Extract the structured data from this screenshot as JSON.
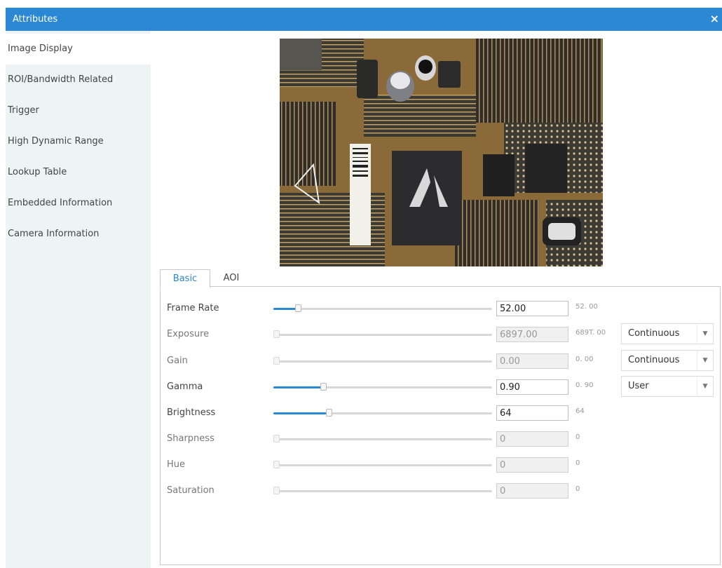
{
  "window": {
    "title": "Attributes",
    "close_glyph": "×"
  },
  "sidebar": {
    "items": [
      {
        "label": "Image Display",
        "active": true
      },
      {
        "label": "ROI/Bandwidth Related",
        "active": false
      },
      {
        "label": "Trigger",
        "active": false
      },
      {
        "label": "High Dynamic Range",
        "active": false
      },
      {
        "label": "Lookup Table",
        "active": false
      },
      {
        "label": "Embedded Information",
        "active": false
      },
      {
        "label": "Camera Information",
        "active": false
      }
    ]
  },
  "tabs": [
    {
      "label": "Basic",
      "active": true
    },
    {
      "label": "AOI",
      "active": false
    }
  ],
  "params": {
    "frame_rate": {
      "label": "Frame Rate",
      "value": "52.00",
      "max": "52. 00",
      "enabled": true,
      "level": 0.11
    },
    "exposure": {
      "label": "Exposure",
      "value": "6897.00",
      "max": "689T. 00",
      "enabled": false,
      "level": 0.0,
      "mode": "Continuous"
    },
    "gain": {
      "label": "Gain",
      "value": "0.00",
      "max": "0. 00",
      "enabled": false,
      "level": 0.0,
      "mode": "Continuous"
    },
    "gamma": {
      "label": "Gamma",
      "value": "0.90",
      "max": "0. 90",
      "enabled": true,
      "level": 0.23,
      "mode": "User"
    },
    "brightness": {
      "label": "Brightness",
      "value": "64",
      "max": "64",
      "enabled": true,
      "level": 0.25
    },
    "sharpness": {
      "label": "Sharpness",
      "value": "0",
      "max": "0",
      "enabled": false,
      "level": 0.0
    },
    "hue": {
      "label": "Hue",
      "value": "0",
      "max": "0",
      "enabled": false,
      "level": 0.0
    },
    "saturation": {
      "label": "Saturation",
      "value": "0",
      "max": "0",
      "enabled": false,
      "level": 0.0
    }
  },
  "icons": {
    "close": "close-icon",
    "dropdown": "chevron-down-icon"
  },
  "colors": {
    "accent": "#2c87d4",
    "sidebar_bg": "#edf4f5"
  }
}
